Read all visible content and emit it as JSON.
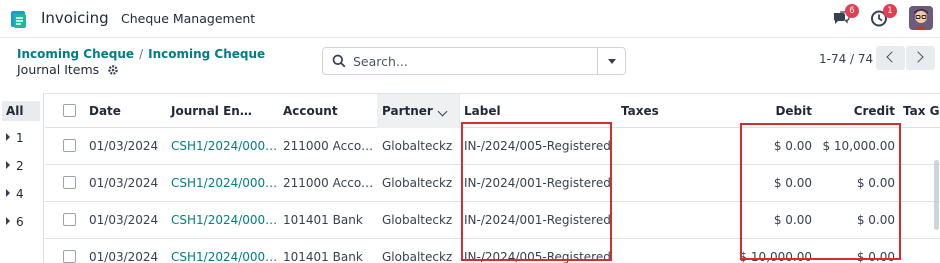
{
  "nav": {
    "app_name": "Invoicing",
    "menu_item": "Cheque Management",
    "messages_badge": "6",
    "activities_badge": "1"
  },
  "control": {
    "breadcrumbs": [
      "Incoming Cheque",
      "Incoming Cheque"
    ],
    "breadcrumb_sep": "/",
    "view_title": "Journal Items",
    "search_placeholder": "Search...",
    "pager": "1-74 / 74"
  },
  "side": {
    "all_label": "All",
    "groups": [
      "1",
      "2",
      "4",
      "6"
    ]
  },
  "list": {
    "columns": {
      "date": "Date",
      "journal_entry": "Journal En…",
      "account": "Account",
      "partner": "Partner",
      "label": "Label",
      "taxes": "Taxes",
      "debit": "Debit",
      "credit": "Credit",
      "tax_grid": "Tax G"
    },
    "rows": [
      {
        "date": "01/03/2024",
        "entry": "CSH1/2024/000…",
        "account": "211000 Acco…",
        "partner": "Globalteckz",
        "label": "IN-/2024/005-Registered",
        "taxes": "",
        "debit": "$ 0.00",
        "credit": "$ 10,000.00"
      },
      {
        "date": "01/03/2024",
        "entry": "CSH1/2024/000…",
        "account": "211000 Acco…",
        "partner": "Globalteckz",
        "label": "IN-/2024/001-Registered",
        "taxes": "",
        "debit": "$ 0.00",
        "credit": "$ 0.00"
      },
      {
        "date": "01/03/2024",
        "entry": "CSH1/2024/000…",
        "account": "101401 Bank",
        "partner": "Globalteckz",
        "label": "IN-/2024/001-Registered",
        "taxes": "",
        "debit": "$ 0.00",
        "credit": "$ 0.00"
      },
      {
        "date": "01/03/2024",
        "entry": "CSH1/2024/000…",
        "account": "101401 Bank",
        "partner": "Globalteckz",
        "label": "IN-/2024/005-Registered",
        "taxes": "",
        "debit": "$ 10,000.00",
        "credit": "$ 0.00"
      }
    ]
  },
  "colors": {
    "link": "#017e84",
    "highlight": "#d32f2f",
    "badge": "#e23f53"
  },
  "icons": [
    "app-logo-icon",
    "chat-icon",
    "clock-icon",
    "avatar",
    "gear-icon",
    "search-icon",
    "chevron-left-icon",
    "chevron-right-icon",
    "caret-down-icon"
  ]
}
